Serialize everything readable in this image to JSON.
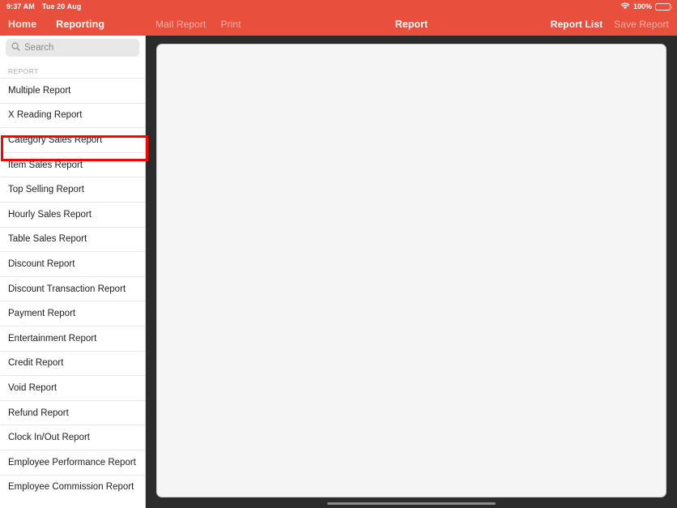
{
  "statusbar": {
    "time": "9:37 AM",
    "date": "Tue 20 Aug",
    "wifi_icon": "wifi-icon",
    "battery_percent": "100%",
    "battery_icon": "battery-full-icon"
  },
  "navbar": {
    "home_label": "Home",
    "reporting_label": "Reporting",
    "mail_report_label": "Mail Report",
    "print_label": "Print",
    "title": "Report",
    "report_list_label": "Report List",
    "save_report_label": "Save Report"
  },
  "sidebar": {
    "search": {
      "placeholder": "Search",
      "value": "",
      "icon": "search-icon"
    },
    "section_title": "REPORT",
    "items": [
      {
        "label": "Multiple Report"
      },
      {
        "label": "X Reading Report"
      },
      {
        "label": "Category Sales Report"
      },
      {
        "label": "Item Sales Report"
      },
      {
        "label": "Top Selling Report"
      },
      {
        "label": "Hourly Sales Report"
      },
      {
        "label": "Table Sales Report"
      },
      {
        "label": "Discount Report"
      },
      {
        "label": "Discount Transaction Report"
      },
      {
        "label": "Payment Report"
      },
      {
        "label": "Entertainment Report"
      },
      {
        "label": "Credit Report"
      },
      {
        "label": "Void Report"
      },
      {
        "label": "Refund Report"
      },
      {
        "label": "Clock In/Out Report"
      },
      {
        "label": "Employee Performance Report"
      },
      {
        "label": "Employee Commission Report"
      }
    ],
    "highlighted_item": "Category Sales Report"
  },
  "main": {
    "content": ""
  },
  "colors": {
    "accent_red": "#E94F3D",
    "annotation_red": "#FF0000",
    "panel_bg": "#f5f5f5",
    "desktop_bg": "#2c2c2c"
  }
}
